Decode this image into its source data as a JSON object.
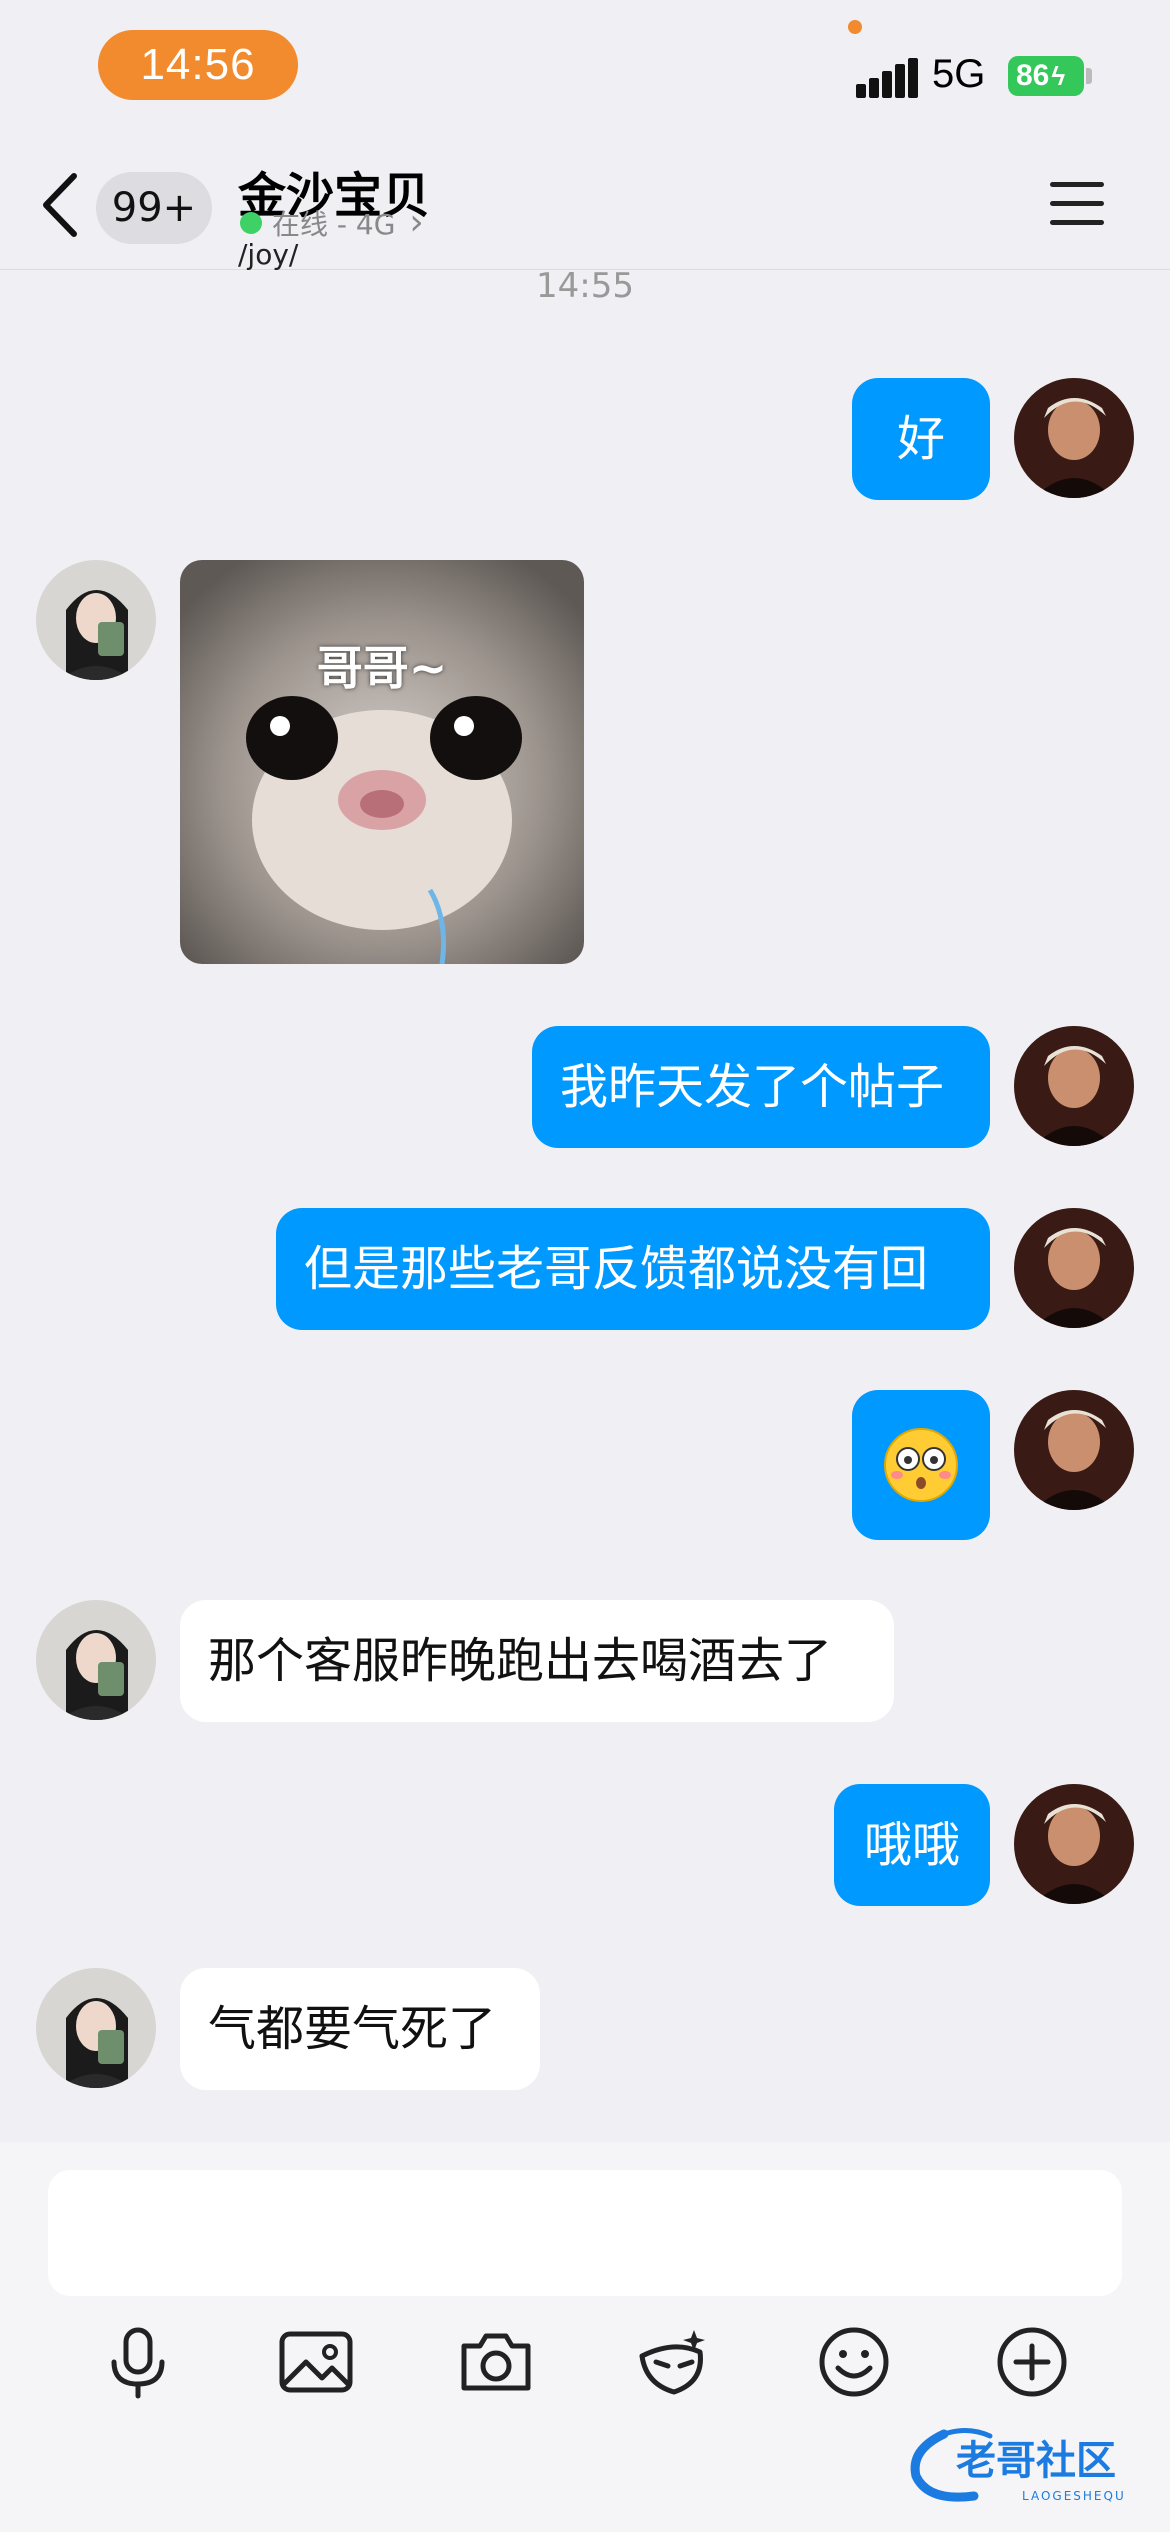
{
  "status_bar": {
    "time": "14:56",
    "network": "5G",
    "battery": "86"
  },
  "nav": {
    "unread_badge": "99+",
    "contact_name": "金沙宝贝",
    "status_text": "在线 - 4G",
    "status_extra": "/joy/",
    "chevron": "›"
  },
  "chat": {
    "timestamp": "14:55",
    "sticker_caption": "哥哥~",
    "emoji": "😳",
    "messages": [
      {
        "sender": "me",
        "text": "好"
      },
      {
        "sender": "them",
        "type": "sticker"
      },
      {
        "sender": "me",
        "text": "我昨天发了个帖子"
      },
      {
        "sender": "me",
        "text": "但是那些老哥反馈都说没有回"
      },
      {
        "sender": "me",
        "type": "emoji"
      },
      {
        "sender": "them",
        "text": "那个客服昨晚跑出去喝酒去了"
      },
      {
        "sender": "me",
        "text": "哦哦"
      },
      {
        "sender": "them",
        "text": "气都要气死了"
      }
    ]
  },
  "input": {
    "value": "",
    "placeholder": ""
  },
  "toolbar": {
    "icons": [
      "microphone-icon",
      "image-icon",
      "camera-icon",
      "sticker-icon",
      "emoji-icon",
      "plus-icon"
    ]
  },
  "watermark": {
    "text": "老哥社区",
    "subtext": "LAOGESHEQU"
  },
  "colors": {
    "my_bubble": "#0099ff",
    "their_bubble": "#ffffff",
    "time_pill": "#f28a2e",
    "battery": "#34c759",
    "background": "#efeff4"
  }
}
